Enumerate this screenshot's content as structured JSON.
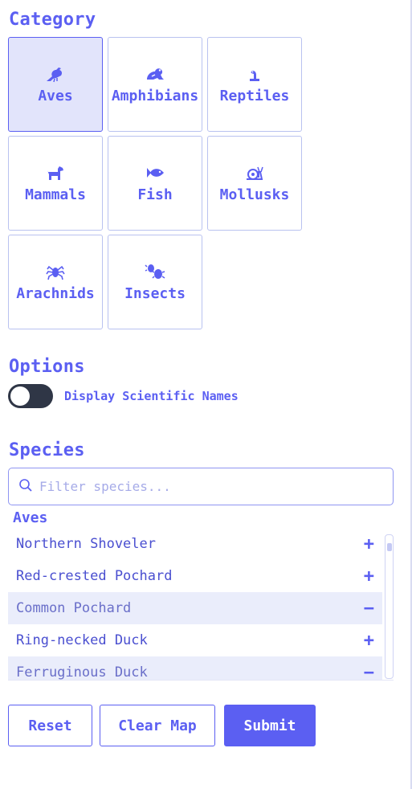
{
  "category": {
    "title": "Category",
    "tiles": [
      {
        "label": "Aves",
        "icon": "bird-icon",
        "selected": true
      },
      {
        "label": "Amphibians",
        "icon": "frog-icon",
        "selected": false
      },
      {
        "label": "Reptiles",
        "icon": "reptile-icon",
        "selected": false
      },
      {
        "label": "Mammals",
        "icon": "dog-icon",
        "selected": false
      },
      {
        "label": "Fish",
        "icon": "fish-icon",
        "selected": false
      },
      {
        "label": "Mollusks",
        "icon": "snail-icon",
        "selected": false
      },
      {
        "label": "Arachnids",
        "icon": "spider-icon",
        "selected": false
      },
      {
        "label": "Insects",
        "icon": "bug-icon",
        "selected": false
      }
    ]
  },
  "options": {
    "title": "Options",
    "toggle_label": "Display Scientific Names",
    "toggle_on": false
  },
  "species": {
    "title": "Species",
    "filter_placeholder": "Filter species...",
    "filter_value": "",
    "group": "Aves",
    "items": [
      {
        "name": "Northern Shoveler",
        "action": "+",
        "selected": false
      },
      {
        "name": "Red-crested Pochard",
        "action": "+",
        "selected": false
      },
      {
        "name": "Common Pochard",
        "action": "−",
        "selected": true
      },
      {
        "name": "Ring-necked Duck",
        "action": "+",
        "selected": false
      },
      {
        "name": "Ferruginous Duck",
        "action": "−",
        "selected": true
      }
    ]
  },
  "buttons": {
    "reset": "Reset",
    "clear_map": "Clear Map",
    "submit": "Submit"
  },
  "colors": {
    "accent": "#5b5ff2",
    "selected_bg": "#e2e4fb",
    "toggle_off": "#2f3646"
  }
}
